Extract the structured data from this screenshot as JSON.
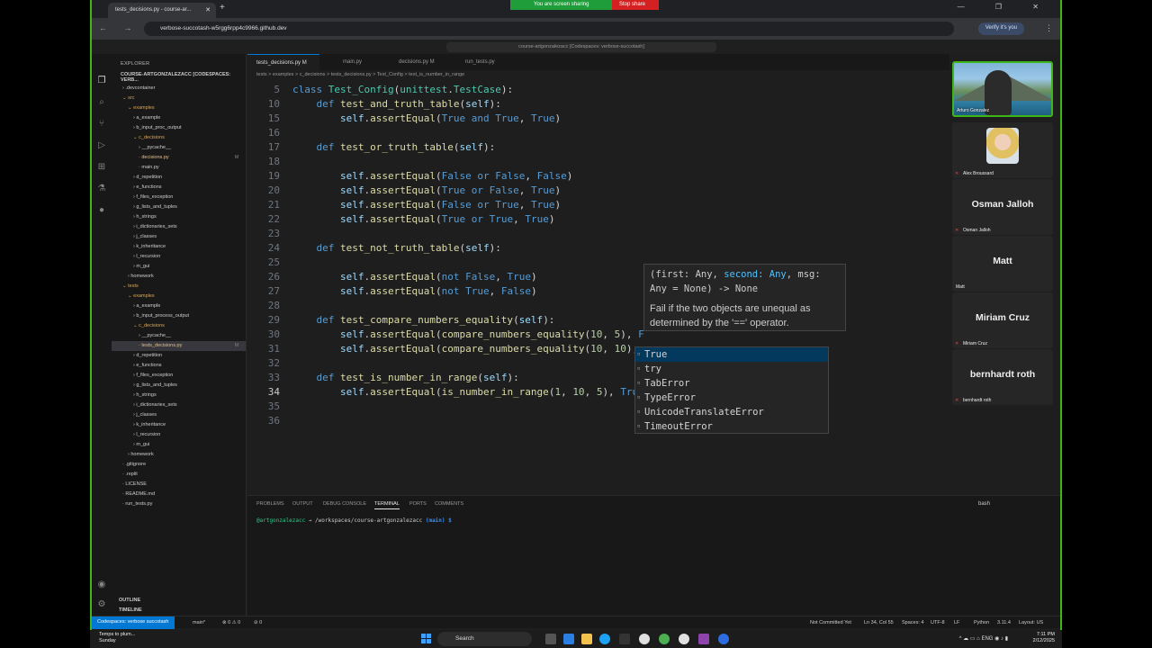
{
  "browser": {
    "tab_title": "tests_decisions.py - course-ar...",
    "tab_close": "✕",
    "new_tab": "+",
    "sharing_text": "You are screen sharing",
    "stop_share": "Stop share",
    "window_controls": "— ❐ ✕",
    "nav_icons": "← → ↻",
    "url": "verbose-succotash-w5rgg6rpp4c9966.github.dev",
    "verify_label": "Verify it's you",
    "menu_icon": "⋮"
  },
  "vscode": {
    "command_center": "course-artgonzalezacc [Codespaces: verbose-succotash]"
  },
  "sidebar": {
    "header": "EXPLORER",
    "root": "COURSE-ARTGONZALEZACC [CODESPACES: VERB...",
    "items": [
      {
        "label": ".devcontainer",
        "indent": 1,
        "type": "folder"
      },
      {
        "label": "src",
        "indent": 1,
        "type": "folder-open"
      },
      {
        "label": "examples",
        "indent": 2,
        "type": "folder-open"
      },
      {
        "label": "a_example",
        "indent": 3,
        "type": "folder"
      },
      {
        "label": "b_input_proc_output",
        "indent": 3,
        "type": "folder"
      },
      {
        "label": "c_decisions",
        "indent": 3,
        "type": "folder-open"
      },
      {
        "label": "__pycache__",
        "indent": 4,
        "type": "folder"
      },
      {
        "label": "decisions.py",
        "indent": 4,
        "type": "modified",
        "badge": "M"
      },
      {
        "label": "main.py",
        "indent": 4,
        "type": "file"
      },
      {
        "label": "d_repetition",
        "indent": 3,
        "type": "folder"
      },
      {
        "label": "e_functions",
        "indent": 3,
        "type": "folder"
      },
      {
        "label": "f_files_exception",
        "indent": 3,
        "type": "folder"
      },
      {
        "label": "g_lists_and_tuples",
        "indent": 3,
        "type": "folder"
      },
      {
        "label": "h_strings",
        "indent": 3,
        "type": "folder"
      },
      {
        "label": "i_dictionaries_sets",
        "indent": 3,
        "type": "folder"
      },
      {
        "label": "j_classes",
        "indent": 3,
        "type": "folder"
      },
      {
        "label": "k_inheritance",
        "indent": 3,
        "type": "folder"
      },
      {
        "label": "l_recursion",
        "indent": 3,
        "type": "folder"
      },
      {
        "label": "m_gui",
        "indent": 3,
        "type": "folder"
      },
      {
        "label": "homework",
        "indent": 2,
        "type": "folder"
      },
      {
        "label": "tests",
        "indent": 1,
        "type": "folder-open"
      },
      {
        "label": "examples",
        "indent": 2,
        "type": "folder-open"
      },
      {
        "label": "a_example",
        "indent": 3,
        "type": "folder"
      },
      {
        "label": "b_input_process_output",
        "indent": 3,
        "type": "folder"
      },
      {
        "label": "c_decisions",
        "indent": 3,
        "type": "folder-open"
      },
      {
        "label": "__pycache__",
        "indent": 4,
        "type": "folder"
      },
      {
        "label": "tests_decisions.py",
        "indent": 4,
        "type": "modified-selected",
        "badge": "M"
      },
      {
        "label": "d_repetition",
        "indent": 3,
        "type": "folder"
      },
      {
        "label": "e_functions",
        "indent": 3,
        "type": "folder"
      },
      {
        "label": "f_files_exception",
        "indent": 3,
        "type": "folder"
      },
      {
        "label": "g_lists_and_tuples",
        "indent": 3,
        "type": "folder"
      },
      {
        "label": "h_strings",
        "indent": 3,
        "type": "folder"
      },
      {
        "label": "i_dictionaries_sets",
        "indent": 3,
        "type": "folder"
      },
      {
        "label": "j_classes",
        "indent": 3,
        "type": "folder"
      },
      {
        "label": "k_inheritance",
        "indent": 3,
        "type": "folder"
      },
      {
        "label": "l_recursion",
        "indent": 3,
        "type": "folder"
      },
      {
        "label": "m_gui",
        "indent": 3,
        "type": "folder"
      },
      {
        "label": "homework",
        "indent": 2,
        "type": "folder"
      },
      {
        "label": ".gitignore",
        "indent": 1,
        "type": "file"
      },
      {
        "label": ".replit",
        "indent": 1,
        "type": "file"
      },
      {
        "label": "LICENSE",
        "indent": 1,
        "type": "file"
      },
      {
        "label": "README.md",
        "indent": 1,
        "type": "file"
      },
      {
        "label": "run_tests.py",
        "indent": 1,
        "type": "file"
      }
    ],
    "outline": "OUTLINE",
    "timeline": "TIMELINE"
  },
  "editor": {
    "tabs": [
      {
        "label": "tests_decisions.py M",
        "active": true
      },
      {
        "label": "main.py",
        "active": false
      },
      {
        "label": "decisions.py M",
        "active": false
      },
      {
        "label": "run_tests.py",
        "active": false
      }
    ],
    "breadcrumb": "tests > examples > c_decisions > tests_decisions.py > Test_Config > test_is_number_in_range",
    "hover": {
      "sig1": "(first: Any, ",
      "sig_kw": "second: Any",
      "sig2": ", msg:",
      "sig3": "Any = None) -> None",
      "doc": "Fail if the two objects are unequal as determined by the '==' operator."
    },
    "suggestions": [
      "True",
      "try",
      "TabError",
      "TypeError",
      "UnicodeTranslateError",
      "TimeoutError"
    ]
  },
  "panel": {
    "tabs": [
      "PROBLEMS",
      "OUTPUT",
      "DEBUG CONSOLE",
      "TERMINAL",
      "PORTS",
      "COMMENTS"
    ],
    "shell": "bash",
    "prompt_user": "@artgonzalezacc",
    "prompt_path": " → /workspaces/course-artgonzalezacc ",
    "prompt_branch": "(main) $"
  },
  "status": {
    "remote": "Codespaces: verbose succotash",
    "branch": "main*",
    "problems": "⊗ 0 ⚠ 0",
    "ports": "⊘ 0",
    "commit": "Not Committed Yet",
    "position": "Ln 34, Col 55",
    "spaces": "Spaces: 4",
    "encoding": "UTF-8",
    "eol": "LF",
    "language": "Python",
    "version": "3.11.4",
    "layout": "Layout: US"
  },
  "participants": [
    {
      "name": "Arturo Gonzalez",
      "video": true
    },
    {
      "name": "Alex Broussard",
      "avatar": true
    },
    {
      "name": "Osman Jalloh"
    },
    {
      "name": "Matt"
    },
    {
      "name": "Miriam Cruz"
    },
    {
      "name": "bernhardt roth"
    }
  ],
  "taskbar": {
    "weather1": "Temps to plum...",
    "weather2": "Sunday",
    "search": "Search",
    "lang": "ENG",
    "time": "7:11 PM",
    "date": "2/12/2025"
  }
}
